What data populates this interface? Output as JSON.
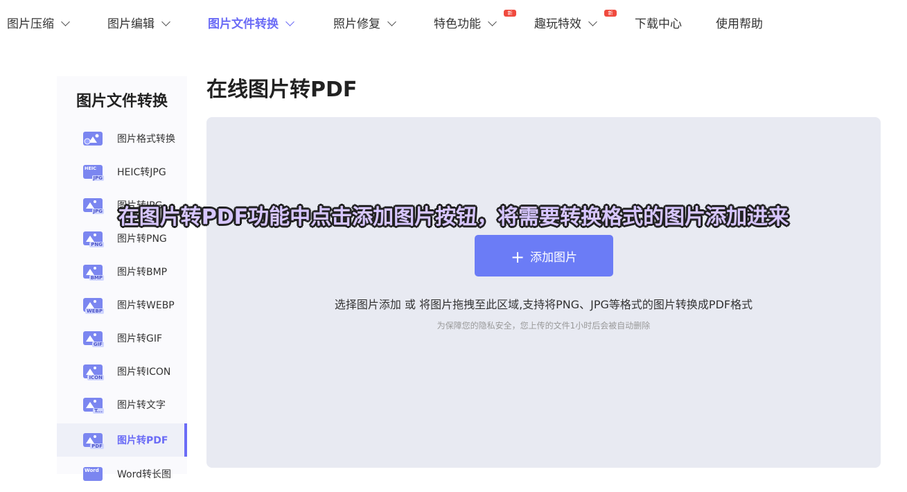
{
  "nav": {
    "items": [
      {
        "label": "图片压缩"
      },
      {
        "label": "图片编辑"
      },
      {
        "label": "图片文件转换"
      },
      {
        "label": "照片修复"
      },
      {
        "label": "特色功能",
        "badge": "新"
      },
      {
        "label": "趣玩特效",
        "badge": "新"
      },
      {
        "label": "下载中心"
      },
      {
        "label": "使用帮助"
      }
    ]
  },
  "sidebar": {
    "title": "图片文件转换",
    "items": [
      {
        "label": "图片格式转换",
        "icon_tag": ""
      },
      {
        "label": "HEIC转JPG",
        "icon_tag": "JPG",
        "icon_text": "HEIC"
      },
      {
        "label": "图片转JPG",
        "icon_tag": "JPG"
      },
      {
        "label": "图片转PNG",
        "icon_tag": "PNG"
      },
      {
        "label": "图片转BMP",
        "icon_tag": "BMP"
      },
      {
        "label": "图片转WEBP",
        "icon_tag": "WEBP"
      },
      {
        "label": "图片转GIF",
        "icon_tag": "GIF"
      },
      {
        "label": "图片转ICON",
        "icon_tag": "ICON"
      },
      {
        "label": "图片转文字",
        "icon_tag": "T..."
      },
      {
        "label": "图片转PDF",
        "icon_tag": "PDF"
      },
      {
        "label": "Word转长图",
        "icon_tag": "",
        "icon_text": "Word"
      }
    ]
  },
  "main": {
    "title": "在线图片转PDF",
    "add_button": "添加图片",
    "hint": "选择图片添加 或 将图片拖拽至此区域,支持将PNG、JPG等格式的图片转换成PDF格式",
    "privacy": "为保障您的隐私安全，您上传的文件1小时后会被自动删除"
  },
  "caption": "在图片转PDF功能中点击添加图片按钮，将需要转换格式的图片添加进来",
  "colors": {
    "accent": "#6b6cf6",
    "button": "#6b7cf6",
    "dropzone": "#e8eaf2",
    "badge": "#f04a3e"
  }
}
